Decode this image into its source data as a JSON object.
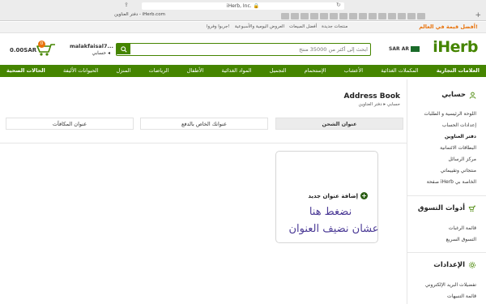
{
  "browser": {
    "url": "iHerb, Inc.",
    "tab_title": "دفتر العناوين - iHerb.com"
  },
  "topbar": {
    "promo": "أفضل قيمة في العالم!",
    "links": [
      "منتجات جديدة",
      "أفضل المبيعات",
      "العروض اليومية والأسبوعية",
      "جربوا وفروا!"
    ]
  },
  "header": {
    "logo": "iHerb",
    "currency": "SAR",
    "language": "AR",
    "search_placeholder": "ابحث إلى أكثر من 35000 منتج",
    "account_name": "malakfaisal7...",
    "account_sub": "حسابي",
    "cart_count": "0",
    "cart_total": "0.00SAR"
  },
  "nav": [
    "العلامات التجارية",
    "المكملات الغذائية",
    "الأعشاب",
    "الإستحمام",
    "التجميل",
    "المواد الغذائية",
    "الأطفال",
    "الرياضات",
    "المنزل",
    "الحيوانات الأليفة",
    "الحالات الصحية"
  ],
  "page": {
    "title": "Address Book",
    "breadcrumb": "حسابي ▸ دفتر العناوين"
  },
  "tabs": {
    "shipping": "عنوان الشحن",
    "billing": "عنوانك الخاص بالدفع",
    "rewards": "عنوان المكافآت"
  },
  "card": {
    "add_label": "إضافة عنوان جديد"
  },
  "annotation": {
    "line1": "نضغط هنا",
    "line2": "عشان نضيف العنوان"
  },
  "sidebar": {
    "account": {
      "title": "حسابي",
      "items": [
        "اللوحة الرئيسية و الطلبات",
        "إعدادات الحساب",
        "دفتر العناوين",
        "البطاقات الائتمانية",
        "مركز الرسائل",
        "منتجاتي وتقييماتي",
        "صفحة iHerb الخاصة بي"
      ]
    },
    "shopping": {
      "title": "أدوات التسوق",
      "items": [
        "قائمة الرغبات",
        "التسوق السريع"
      ]
    },
    "settings": {
      "title": "الإعدادات",
      "items": [
        "تفضيلات البريد الإلكتروني",
        "قائمة التنبيهات"
      ]
    }
  },
  "colors": {
    "brand_green": "#458500",
    "accent_orange": "#e8730c",
    "annotation_purple": "#4b3a96"
  }
}
